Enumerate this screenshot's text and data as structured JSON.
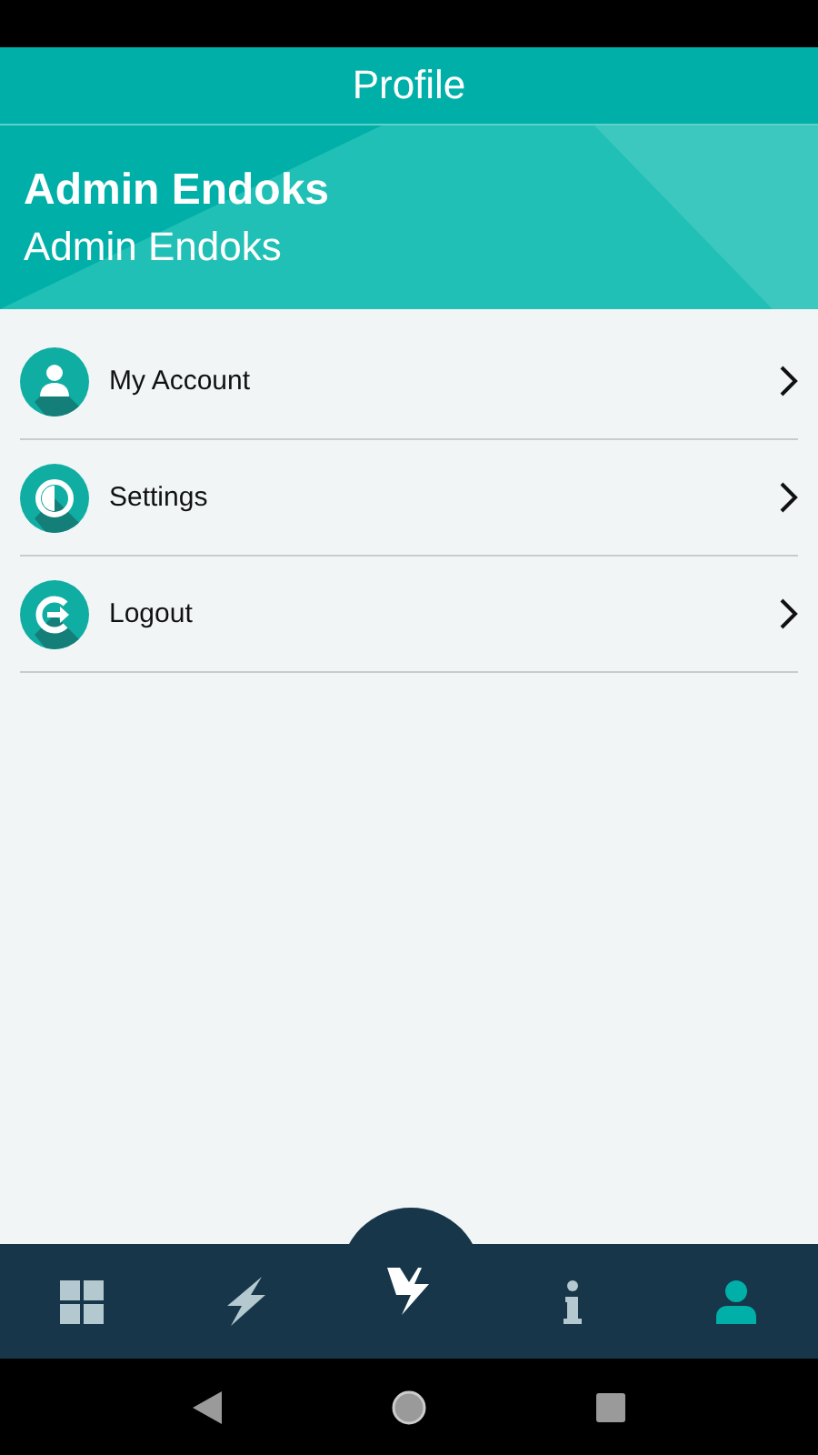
{
  "app_bar": {
    "title": "Profile"
  },
  "header": {
    "name": "Admin Endoks",
    "subtitle": "Admin Endoks"
  },
  "menu": [
    {
      "kind": "account",
      "label": "My Account"
    },
    {
      "kind": "settings",
      "label": "Settings"
    },
    {
      "kind": "logout",
      "label": "Logout"
    }
  ],
  "bottom_nav": [
    {
      "kind": "grid",
      "selected": false
    },
    {
      "kind": "bolt",
      "selected": false
    },
    {
      "kind": "center",
      "selected": false
    },
    {
      "kind": "info",
      "selected": false
    },
    {
      "kind": "profile",
      "selected": true
    }
  ]
}
